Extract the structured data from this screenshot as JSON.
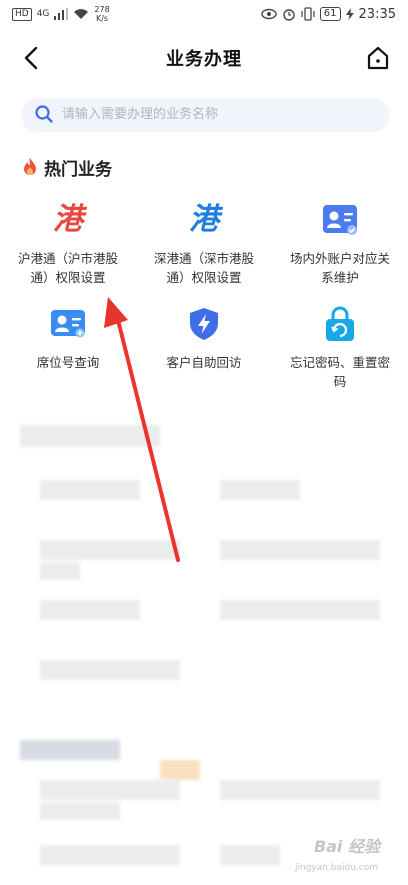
{
  "status_bar": {
    "network": "HD",
    "signal": "4G",
    "speed": "278\nK/s",
    "battery": "61",
    "time": "23:35"
  },
  "header": {
    "title": "业务办理"
  },
  "search": {
    "placeholder": "请输入需要办理的业务名称",
    "value": ""
  },
  "hot": {
    "title": "热门业务",
    "items": [
      {
        "label": "沪港通（沪市港股通）权限设置",
        "icon_char": "港",
        "icon": "gang-red-icon",
        "color": "#e8483f"
      },
      {
        "label": "深港通（深市港股通）权限设置",
        "icon_char": "港",
        "icon": "gang-blue-icon",
        "color": "#1f7fe0"
      },
      {
        "label": "场内外账户对应关系维护",
        "icon": "account-card-icon",
        "color": "#4a7cf0"
      },
      {
        "label": "席位号查询",
        "icon": "id-card-icon",
        "color": "#3a8cf0"
      },
      {
        "label": "客户自助回访",
        "icon": "shield-bolt-icon",
        "color": "#3e6fe8"
      },
      {
        "label": "忘记密码、重置密码",
        "icon": "lock-reset-icon",
        "color": "#18a8e8"
      }
    ]
  },
  "watermark": {
    "brand": "Bai 经验",
    "sub": "jingyan.baidu.com"
  },
  "colors": {
    "accent": "#4a7cf0",
    "arrow": "#e8352c",
    "search_bg": "#f1f4fa"
  }
}
